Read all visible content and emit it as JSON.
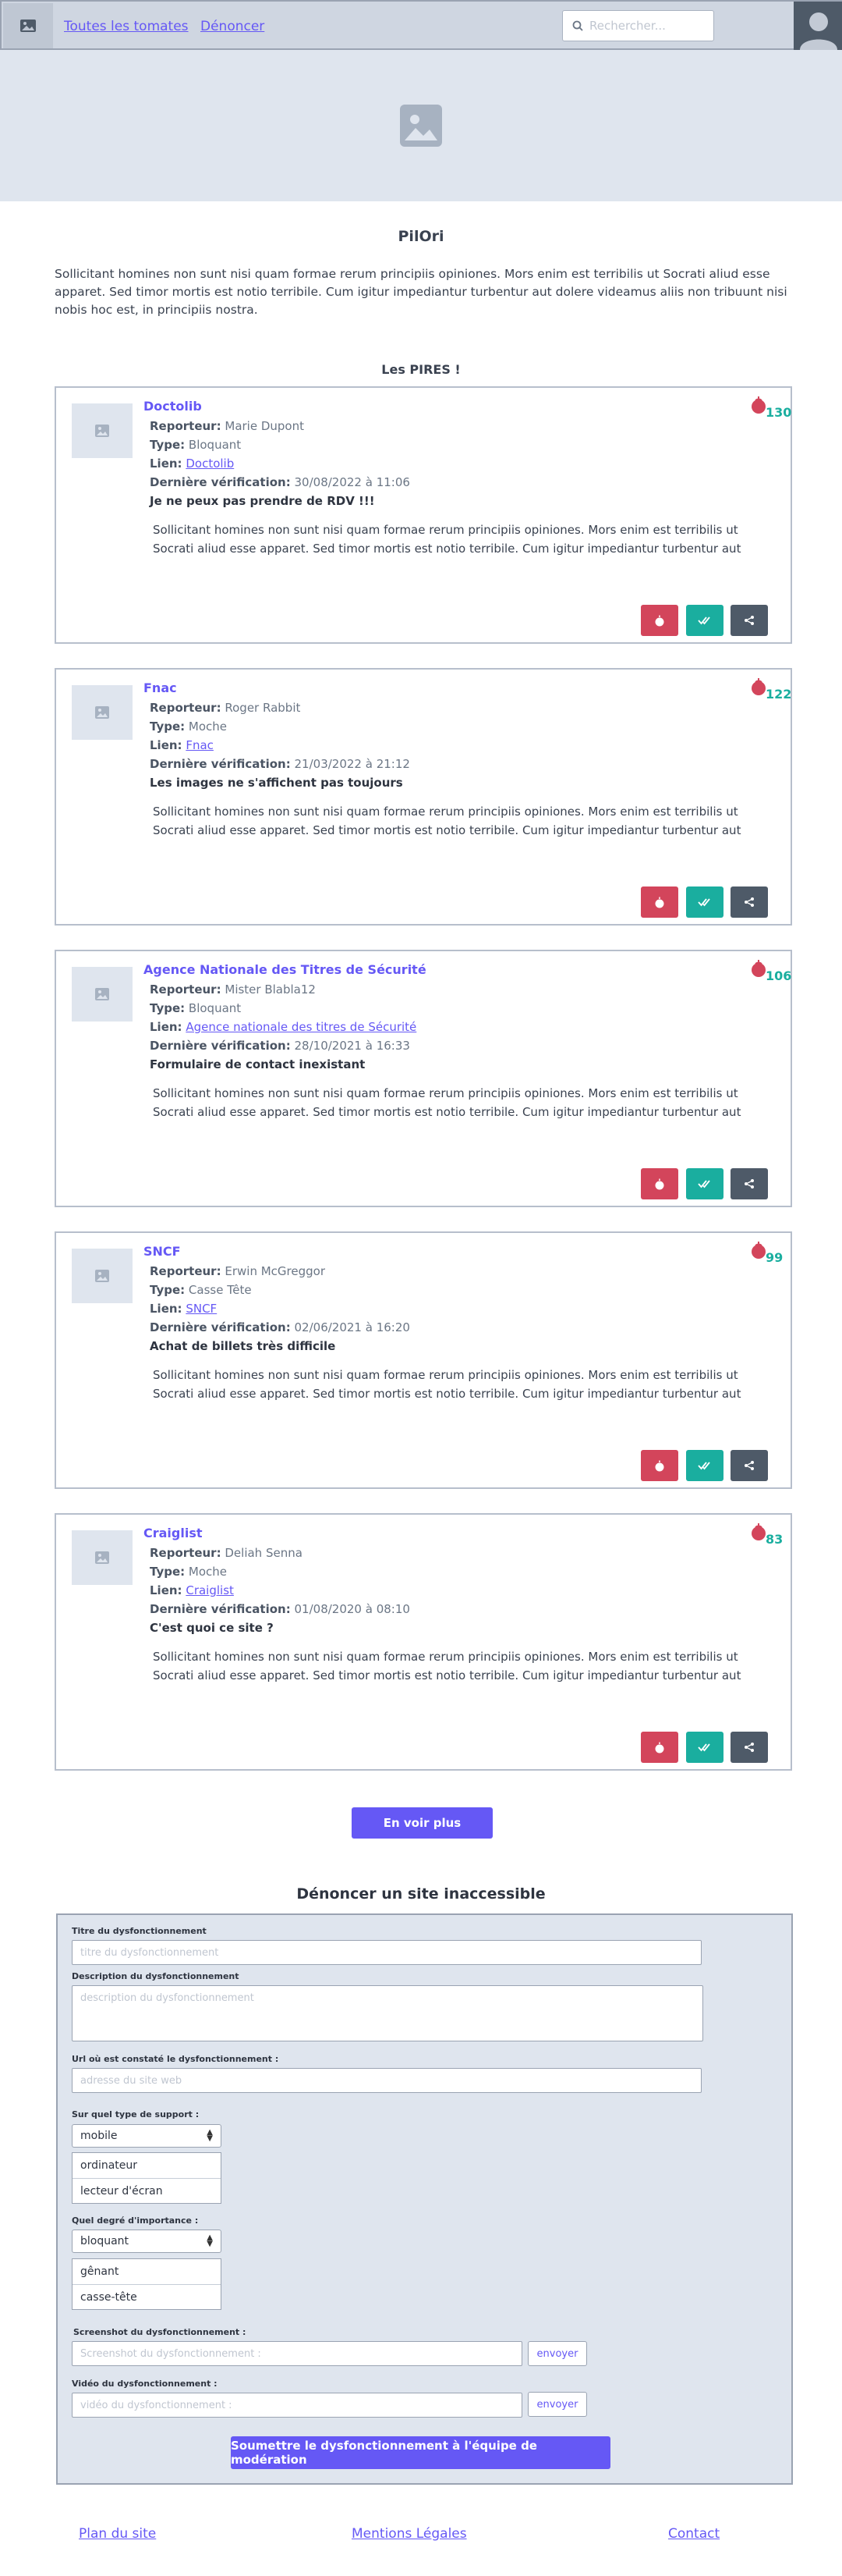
{
  "header": {
    "nav": [
      "Toutes les tomates",
      "Dénoncer"
    ],
    "search_placeholder": "Rechercher..."
  },
  "page": {
    "title": "PilOri",
    "intro": "Sollicitant homines non sunt nisi quam formae rerum principiis opiniones. Mors enim est terribilis ut Socrati aliud esse apparet. Sed timor mortis est notio terribile. Cum igitur impediantur turbentur aut dolere videamus aliis non tribuunt nisi nobis hoc est, in principiis nostra.",
    "worst_title": "Les PIRES !"
  },
  "labels": {
    "reporter": "Reporteur:",
    "type": "Type:",
    "link": "Lien:",
    "verified": "Dernière vérification:"
  },
  "cards": [
    {
      "name": "Doctolib",
      "score": "130",
      "reporter": "Marie Dupont",
      "type": "Bloquant",
      "link": "Doctolib",
      "verified": "30/08/2022 à 11:06",
      "headline": "Je ne peux pas prendre de RDV !!!",
      "desc": "Sollicitant homines non sunt nisi quam formae rerum principiis opiniones. Mors enim est terribilis ut Socrati aliud esse apparet. Sed timor mortis est notio terribile. Cum igitur impediantur turbentur aut"
    },
    {
      "name": "Fnac",
      "score": "122",
      "reporter": "Roger Rabbit",
      "type": "Moche",
      "link": "Fnac",
      "verified": "21/03/2022 à 21:12",
      "headline": "Les images ne s'affichent pas toujours",
      "desc": "Sollicitant homines non sunt nisi quam formae rerum principiis opiniones. Mors enim est terribilis ut Socrati aliud esse apparet. Sed timor mortis est notio terribile. Cum igitur impediantur turbentur aut"
    },
    {
      "name": "Agence Nationale des Titres de Sécurité",
      "score": "106",
      "reporter": "Mister Blabla12",
      "type": "Bloquant",
      "link": "Agence nationale des titres de Sécurité",
      "verified": "28/10/2021 à 16:33",
      "headline": "Formulaire de contact inexistant",
      "desc": "Sollicitant homines non sunt nisi quam formae rerum principiis opiniones. Mors enim est terribilis ut Socrati aliud esse apparet. Sed timor mortis est notio terribile. Cum igitur impediantur turbentur aut"
    },
    {
      "name": "SNCF",
      "score": "99",
      "reporter": "Erwin McGreggor",
      "type": "Casse Tête",
      "link": "SNCF",
      "verified": "02/06/2021 à 16:20",
      "headline": "Achat de billets très difficile",
      "desc": "Sollicitant homines non sunt nisi quam formae rerum principiis opiniones. Mors enim est terribilis ut Socrati aliud esse apparet. Sed timor mortis est notio terribile. Cum igitur impediantur turbentur aut"
    },
    {
      "name": "Craiglist",
      "score": "83",
      "reporter": "Deliah Senna",
      "type": "Moche",
      "link": "Craiglist",
      "verified": "01/08/2020 à 08:10",
      "headline": "C'est quoi ce site ?",
      "desc": "Sollicitant homines non sunt nisi quam formae rerum principiis opiniones. Mors enim est terribilis ut Socrati aliud esse apparet. Sed timor mortis est notio terribile. Cum igitur impediantur turbentur aut"
    }
  ],
  "more_button": "En voir plus",
  "form": {
    "title": "Dénoncer un site inaccessible",
    "title_label": "Titre du dysfonctionnement",
    "title_placeholder": "titre du dysfonctionnement",
    "desc_label": "Description du dysfonctionnement",
    "desc_placeholder": "description du dysfonctionnement",
    "url_label": "Url où est constaté le dysfonctionnement :",
    "url_placeholder": "adresse du site web",
    "support_label": "Sur quel type de support :",
    "support_selected": "mobile",
    "support_options": [
      "ordinateur",
      "lecteur d'écran"
    ],
    "importance_label": "Quel degré d'importance :",
    "importance_selected": "bloquant",
    "importance_options": [
      "gênant",
      "casse-tête"
    ],
    "screenshot_label": "Screenshot du dysfonctionnement :",
    "screenshot_placeholder": "Screenshot du dysfonctionnement :",
    "video_label": "Vidéo du dysfonctionnement :",
    "video_placeholder": "vidéo du dysfonctionnement :",
    "send_label": "envoyer",
    "submit": "Soumettre le dysfonctionnement à l'équipe de modération"
  },
  "footer": {
    "links": [
      "Plan du site",
      "Mentions Légales",
      "Contact"
    ]
  },
  "colors": {
    "accent": "#6558f5",
    "red": "#d3455b",
    "teal": "#1aae9f",
    "dark": "#4e5a68",
    "panel": "#dfe5ee"
  },
  "icons": {
    "logo": "image-icon",
    "search": "search-icon",
    "avatar": "user-avatar-icon",
    "tomato": "tomato-icon",
    "check": "double-check-icon",
    "share": "share-icon"
  }
}
